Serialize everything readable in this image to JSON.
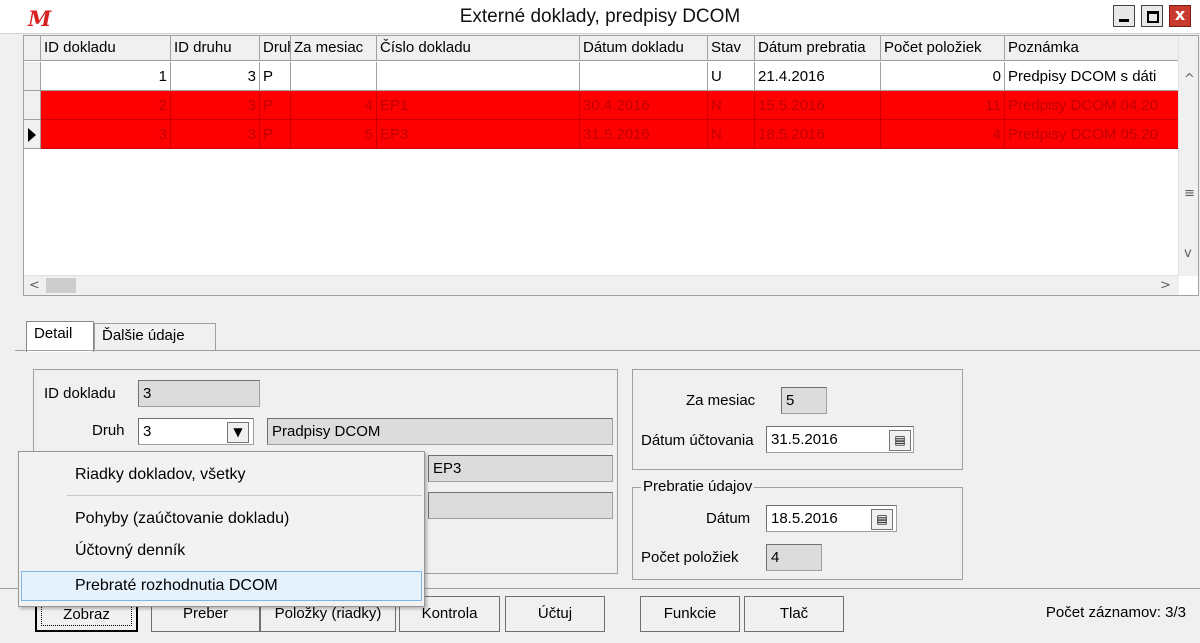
{
  "window": {
    "logo": "M",
    "title": "Externé doklady, predpisy DCOM",
    "close_glyph": "x",
    "colors": {
      "row_highlight": "#ff0000",
      "row_text": "#c00000",
      "logo": "#d82020"
    }
  },
  "grid": {
    "columns": [
      "ID dokladu",
      "ID druhu",
      "Druh",
      "Za mesiac",
      "Číslo dokladu",
      "Dátum dokladu",
      "Stav",
      "Dátum prebratia",
      "Počet položiek",
      "Poznámka"
    ],
    "rows": [
      {
        "id": "1",
        "id_druhu": "3",
        "druh": "P",
        "za_mesiac": "",
        "cislo": "",
        "datum": "",
        "stav": "U",
        "prebratie": "21.4.2016",
        "pocet": "0",
        "poznamka": "Predpisy DCOM s dáti",
        "highlight": false,
        "current": false
      },
      {
        "id": "2",
        "id_druhu": "3",
        "druh": "P",
        "za_mesiac": "4",
        "cislo": "EP1",
        "datum": "30.4.2016",
        "stav": "N",
        "prebratie": "15.5.2016",
        "pocet": "11",
        "poznamka": "Predpisy DCOM 04.20",
        "highlight": true,
        "current": false
      },
      {
        "id": "3",
        "id_druhu": "3",
        "druh": "P",
        "za_mesiac": "5",
        "cislo": "EP3",
        "datum": "31.5.2016",
        "stav": "N",
        "prebratie": "18.5.2016",
        "pocet": "4",
        "poznamka": "Predpisy DCOM 05.20",
        "highlight": true,
        "current": true
      }
    ],
    "scroll_up": "^",
    "scroll_down": "v",
    "scroll_left": "<",
    "scroll_right": ">",
    "scroll_thumb": "≡"
  },
  "tabs": [
    "Detail",
    "Ďalšie údaje"
  ],
  "detail": {
    "id_label": "ID dokladu",
    "id_value": "3",
    "druh_label": "Druh",
    "druh_value": "3",
    "druh_name": "Pradpisy DCOM",
    "cislo_value": "EP3",
    "za_mesiac_label": "Za mesiac",
    "za_mesiac_value": "5",
    "datum_uct_label": "Dátum účtovania",
    "datum_uct_value": "31.5.2016",
    "prebratie_legend": "Prebratie údajov",
    "datum_label": "Dátum",
    "datum_value": "18.5.2016",
    "pocet_label": "Počet položiek",
    "pocet_value": "4"
  },
  "popup_menu": {
    "items": [
      "Riadky dokladov, všetky",
      "Pohyby (zaúčtovanie dokladu)",
      "Účtovný denník",
      "Prebraté rozhodnutia DCOM"
    ],
    "highlighted": "Prebraté rozhodnutia DCOM"
  },
  "buttons": [
    "Zobraz",
    "Preber",
    "Položky (riadky)",
    "Kontrola",
    "Účtuj",
    "Funkcie",
    "Tlač"
  ],
  "status": {
    "count": "Počet záznamov: 3/3"
  }
}
